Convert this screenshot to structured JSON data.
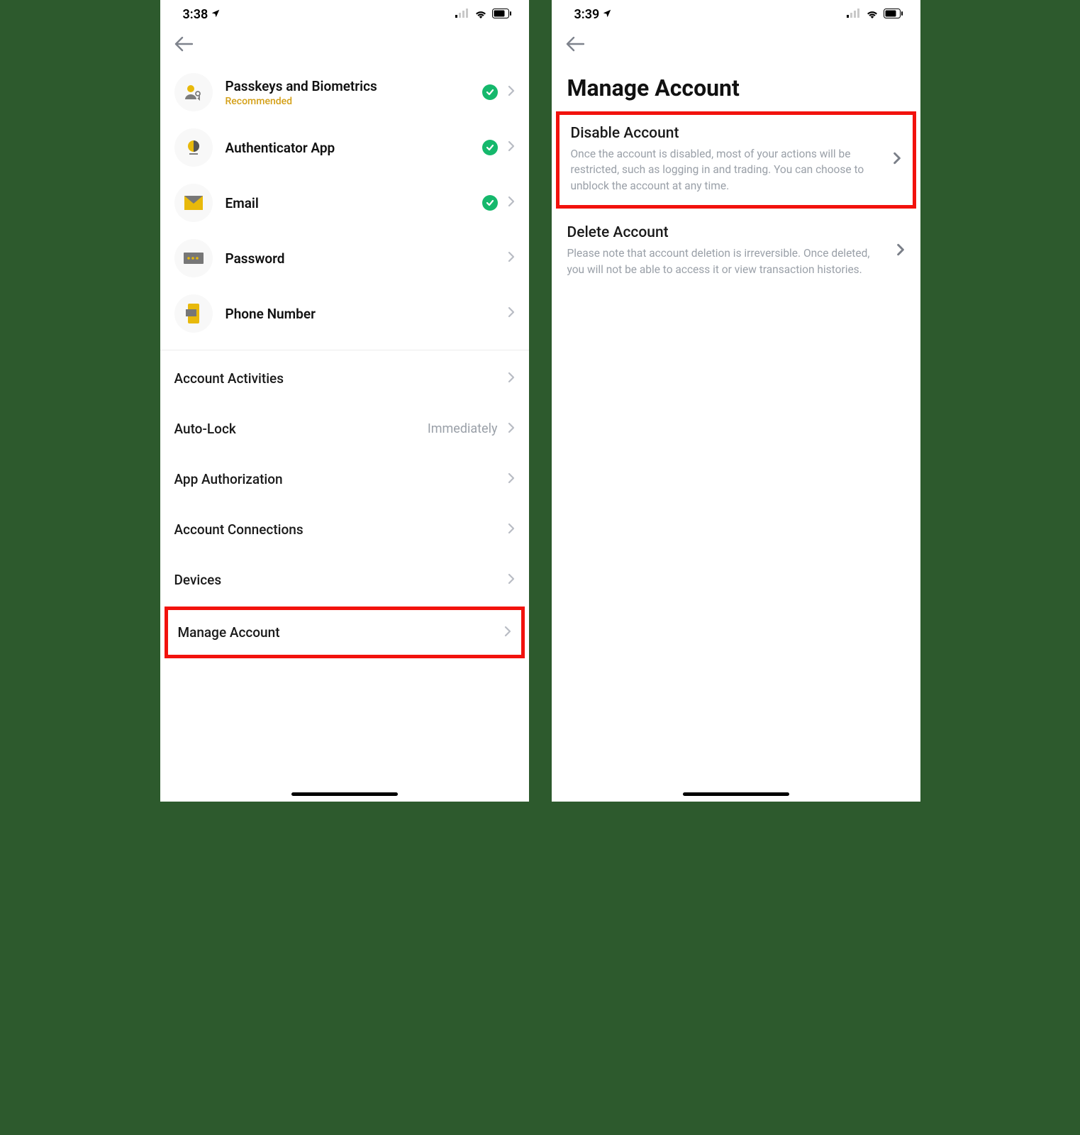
{
  "left": {
    "status": {
      "time": "3:38"
    },
    "security": [
      {
        "title": "Passkeys and Biometrics",
        "badge": "Recommended",
        "checked": true,
        "icon": "passkey"
      },
      {
        "title": "Authenticator App",
        "badge": "",
        "checked": true,
        "icon": "auth"
      },
      {
        "title": "Email",
        "badge": "",
        "checked": true,
        "icon": "email"
      },
      {
        "title": "Password",
        "badge": "",
        "checked": false,
        "icon": "password"
      },
      {
        "title": "Phone Number",
        "badge": "",
        "checked": false,
        "icon": "phone"
      }
    ],
    "rows": [
      {
        "label": "Account Activities",
        "value": ""
      },
      {
        "label": "Auto-Lock",
        "value": "Immediately"
      },
      {
        "label": "App Authorization",
        "value": ""
      },
      {
        "label": "Account Connections",
        "value": ""
      },
      {
        "label": "Devices",
        "value": ""
      },
      {
        "label": "Manage Account",
        "value": ""
      }
    ]
  },
  "right": {
    "status": {
      "time": "3:39"
    },
    "title": "Manage Account",
    "cards": [
      {
        "title": "Disable Account",
        "desc": "Once the account is disabled, most of your actions will be restricted, such as logging in and trading. You can choose to unblock the account at any time."
      },
      {
        "title": "Delete Account",
        "desc": "Please note that account deletion is irreversible. Once deleted, you will not be able to access it or view transaction histories."
      }
    ]
  }
}
